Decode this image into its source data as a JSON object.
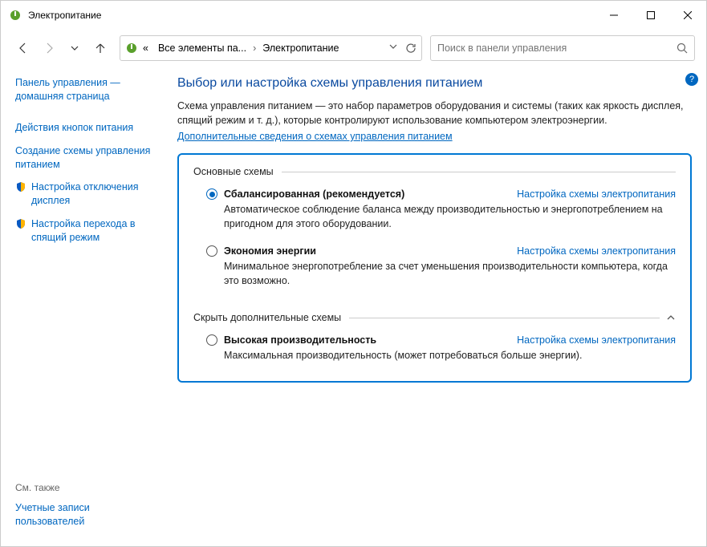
{
  "window": {
    "title": "Электропитание"
  },
  "breadcrumb": {
    "prefix": "«",
    "parent": "Все элементы па...",
    "current": "Электропитание"
  },
  "search": {
    "placeholder": "Поиск в панели управления"
  },
  "sidebar": {
    "home": "Панель управления — домашняя страница",
    "links": {
      "buttons": "Действия кнопок питания",
      "create": "Создание схемы управления питанием",
      "display": "Настройка отключения дисплея",
      "sleep": "Настройка перехода в спящий режим"
    },
    "seealso_label": "См. также",
    "seealso_link": "Учетные записи пользователей"
  },
  "main": {
    "heading": "Выбор или настройка схемы управления питанием",
    "intro": "Схема управления питанием — это набор параметров оборудования и системы (таких как яркость дисплея, спящий режим и т. д.), которые контролируют использование компьютером электроэнергии.",
    "learn_more": "Дополнительные сведения о схемах управления питанием",
    "group1_label": "Основные схемы",
    "group2_label": "Скрыть дополнительные схемы",
    "change_settings": "Настройка схемы электропитания",
    "plans": {
      "balanced": {
        "name": "Сбалансированная (рекомендуется)",
        "desc": "Автоматическое соблюдение баланса между производительностью и энергопотреблением на пригодном для этого оборудовании."
      },
      "saver": {
        "name": "Экономия энергии",
        "desc": "Минимальное энергопотребление за счет уменьшения производительности компьютера, когда это возможно."
      },
      "high": {
        "name": "Высокая производительность",
        "desc": "Максимальная производительность (может потребоваться больше энергии)."
      }
    }
  }
}
